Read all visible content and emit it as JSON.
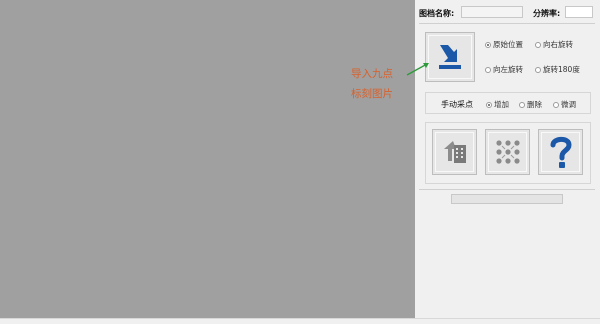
{
  "header": {
    "name_label": "图档名称:",
    "name_value": "",
    "resolution_label": "分辨率:",
    "resolution_value": ""
  },
  "import_button_icon": "import-arrow-icon",
  "rotation_options": [
    {
      "label": "原始位置",
      "selected": true
    },
    {
      "label": "向右旋转",
      "selected": false
    },
    {
      "label": "向左旋转",
      "selected": false
    },
    {
      "label": "旋转180度",
      "selected": false
    }
  ],
  "manual_point": {
    "label": "手动采点",
    "options": [
      {
        "label": "增加",
        "selected": true
      },
      {
        "label": "删除",
        "selected": false
      },
      {
        "label": "微调",
        "selected": false
      }
    ]
  },
  "tool_buttons": [
    {
      "icon": "building-exit-icon"
    },
    {
      "icon": "nine-point-grid-icon"
    },
    {
      "icon": "question-mark-icon"
    }
  ],
  "annotation": {
    "line1": "导入九点",
    "line2": "标刻图片"
  },
  "colors": {
    "accent_blue": "#1b58a8",
    "annotation_orange": "#d9602a",
    "arrow_green": "#2e9a3c"
  },
  "progress": {
    "value": 0
  }
}
